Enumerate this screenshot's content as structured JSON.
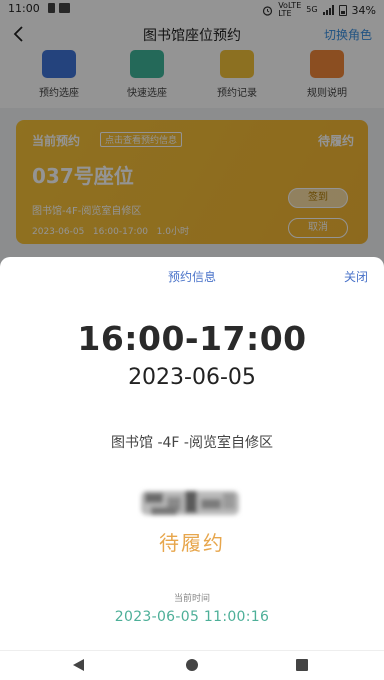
{
  "status_bar": {
    "time": "11:00",
    "network_top": "VoLTE",
    "network_bottom": "LTE",
    "signal": "5G",
    "battery": "34%"
  },
  "header": {
    "title": "图书馆座位预约",
    "switch_role": "切换角色"
  },
  "quick_nav": [
    {
      "label": "预约选座",
      "color": "#3e74d8",
      "icon": "calendar-icon"
    },
    {
      "label": "快速选座",
      "color": "#3fb59a",
      "icon": "seat-icon"
    },
    {
      "label": "预约记录",
      "color": "#f2c23a",
      "icon": "folder-icon"
    },
    {
      "label": "规则说明",
      "color": "#f0873a",
      "icon": "help-icon"
    }
  ],
  "current_card": {
    "label": "当前预约",
    "tag": "点击查看预约信息",
    "status": "待履约",
    "seat": "037号座位",
    "location": "图书馆-4F-阅览室自修区",
    "date": "2023-06-05",
    "time_range": "16:00-17:00",
    "duration": "1.0小时",
    "checkin_label": "签到",
    "cancel_label": "取消"
  },
  "modal": {
    "title": "预约信息",
    "close_label": "关闭",
    "time_range": "16:00-17:00",
    "date": "2023-06-05",
    "location": "图书馆 -4F -阅览室自修区",
    "status": "待履约",
    "now_label": "当前时间",
    "now_value": "2023-06-05 11:00:16"
  },
  "colors": {
    "accent_blue": "#4a73c9",
    "status_orange": "#e7a64c",
    "now_teal": "#4daf98"
  }
}
